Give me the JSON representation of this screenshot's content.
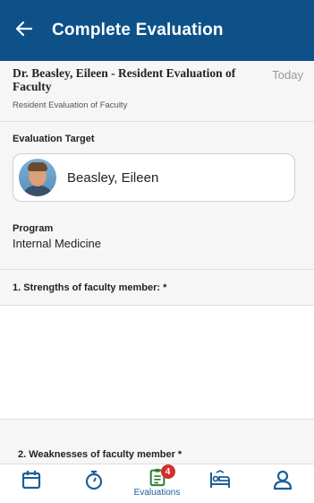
{
  "app_bar": {
    "title": "Complete Evaluation"
  },
  "evaluation": {
    "title": "Dr. Beasley, Eileen - Resident Evaluation of Faculty",
    "date": "Today",
    "type": "Resident Evaluation of Faculty"
  },
  "target": {
    "label": "Evaluation Target",
    "name": "Beasley, Eileen"
  },
  "program": {
    "label": "Program",
    "value": "Internal Medicine"
  },
  "questions": [
    {
      "text": "1. Strengths of faculty member: *",
      "answer": ""
    },
    {
      "text": "2. Weaknesses of faculty member *"
    }
  ],
  "bottom_nav": {
    "items": [
      {
        "icon": "calendar-icon"
      },
      {
        "icon": "stopwatch-icon"
      },
      {
        "icon": "clipboard-icon",
        "label": "Evaluations",
        "badge": "4"
      },
      {
        "icon": "patient-bed-icon"
      },
      {
        "icon": "user-icon"
      }
    ]
  },
  "colors": {
    "primary": "#0e5189",
    "badge": "#d32f2f",
    "nav_icon": "#1b5f98"
  }
}
